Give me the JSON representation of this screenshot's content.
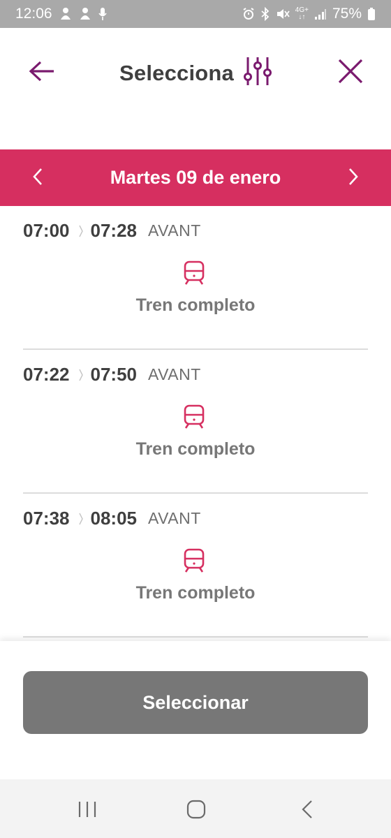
{
  "status_bar": {
    "time": "12:06",
    "network": "4G+",
    "battery": "75%",
    "left_icons": [
      "notification-icon",
      "notification-icon",
      "microphone-icon"
    ],
    "right_icons": [
      "alarm-icon",
      "bluetooth-icon",
      "mute-icon",
      "signal-icon",
      "battery-icon"
    ]
  },
  "header": {
    "title": "Selecciona",
    "back_icon": "arrow-left-icon",
    "filter_icon": "sliders-icon",
    "close_icon": "close-icon"
  },
  "date_bar": {
    "label": "Martes 09 de enero",
    "prev_icon": "chevron-left-icon",
    "next_icon": "chevron-right-icon"
  },
  "trains": [
    {
      "departure": "07:00",
      "arrival": "07:28",
      "type": "AVANT",
      "status": "Tren completo"
    },
    {
      "departure": "07:22",
      "arrival": "07:50",
      "type": "AVANT",
      "status": "Tren completo"
    },
    {
      "departure": "07:38",
      "arrival": "08:05",
      "type": "AVANT",
      "status": "Tren completo"
    }
  ],
  "footer": {
    "select_label": "Seleccionar"
  },
  "colors": {
    "accent": "#d62f60",
    "icon_purple": "#7a1a6e",
    "button_disabled": "#777777",
    "status_bar": "#a9a9a9"
  }
}
